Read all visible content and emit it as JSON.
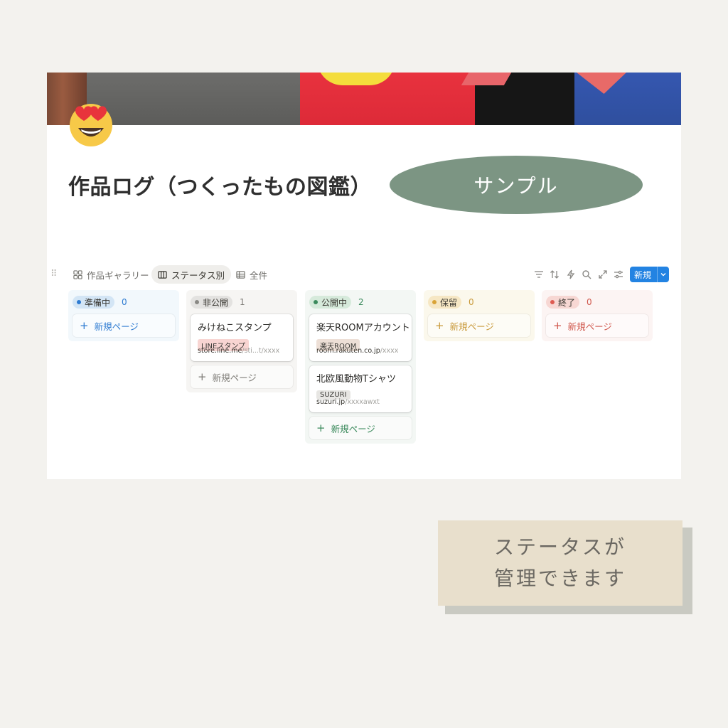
{
  "page": {
    "title": "作品ログ（つくったもの図鑑）",
    "sample_badge": "サンプル",
    "icon": "heart-eyes-emoji-icon",
    "cover": "t-shirts-photo"
  },
  "views": [
    {
      "label": "作品ギャラリー",
      "icon": "gallery-icon",
      "active": false
    },
    {
      "label": "ステータス別",
      "icon": "board-icon",
      "active": true
    },
    {
      "label": "全件",
      "icon": "table-icon",
      "active": false
    }
  ],
  "toolbar": {
    "icons": [
      "filter-icon",
      "sort-icon",
      "automation-icon",
      "search-icon",
      "expand-icon",
      "settings-icon"
    ],
    "new_label": "新規"
  },
  "board": {
    "add_page_label": "新規ページ",
    "columns": [
      {
        "name": "準備中",
        "count": "0",
        "accent": "#2e7bd1",
        "pill_bg": "#d3e5f5",
        "bg": "#f2f8fc",
        "dot": "#2e7bd1",
        "cards": []
      },
      {
        "name": "非公開",
        "count": "1",
        "accent": "#7f7d78",
        "pill_bg": "#e3e2e0",
        "bg": "#f6f5f3",
        "dot": "#8a8985",
        "cards": [
          {
            "title": "みけねこスタンプ",
            "tag": "LINEスタンプ",
            "tag_color": "#f8d5d2",
            "url_host": "store.line.me",
            "url_path": "/sti...t/xxxx"
          }
        ]
      },
      {
        "name": "公開中",
        "count": "2",
        "accent": "#3b8a5c",
        "pill_bg": "#d6eadb",
        "bg": "#f3f7f4",
        "dot": "#3b8a5c",
        "cards": [
          {
            "title": "楽天ROOMアカウント",
            "tag": "楽天ROOM",
            "tag_color": "#eddfd6",
            "url_host": "room.rakuten.co.jp",
            "url_path": "/xxxx"
          },
          {
            "title": "北欧風動物Tシャツ",
            "tag": "SUZURI",
            "tag_color": "#e7e6e3",
            "url_host": "suzuri.jp",
            "url_path": "/xxxxawxt"
          }
        ]
      },
      {
        "name": "保留",
        "count": "0",
        "accent": "#c99a3b",
        "pill_bg": "#f6e7c4",
        "bg": "#fbf8ec",
        "dot": "#d9a336",
        "cards": []
      },
      {
        "name": "終了",
        "count": "0",
        "accent": "#d0574c",
        "pill_bg": "#f7d7d3",
        "bg": "#fcf4f3",
        "dot": "#de5b51",
        "cards": []
      }
    ]
  },
  "caption": {
    "line1": "ステータスが",
    "line2": "管理できます"
  }
}
